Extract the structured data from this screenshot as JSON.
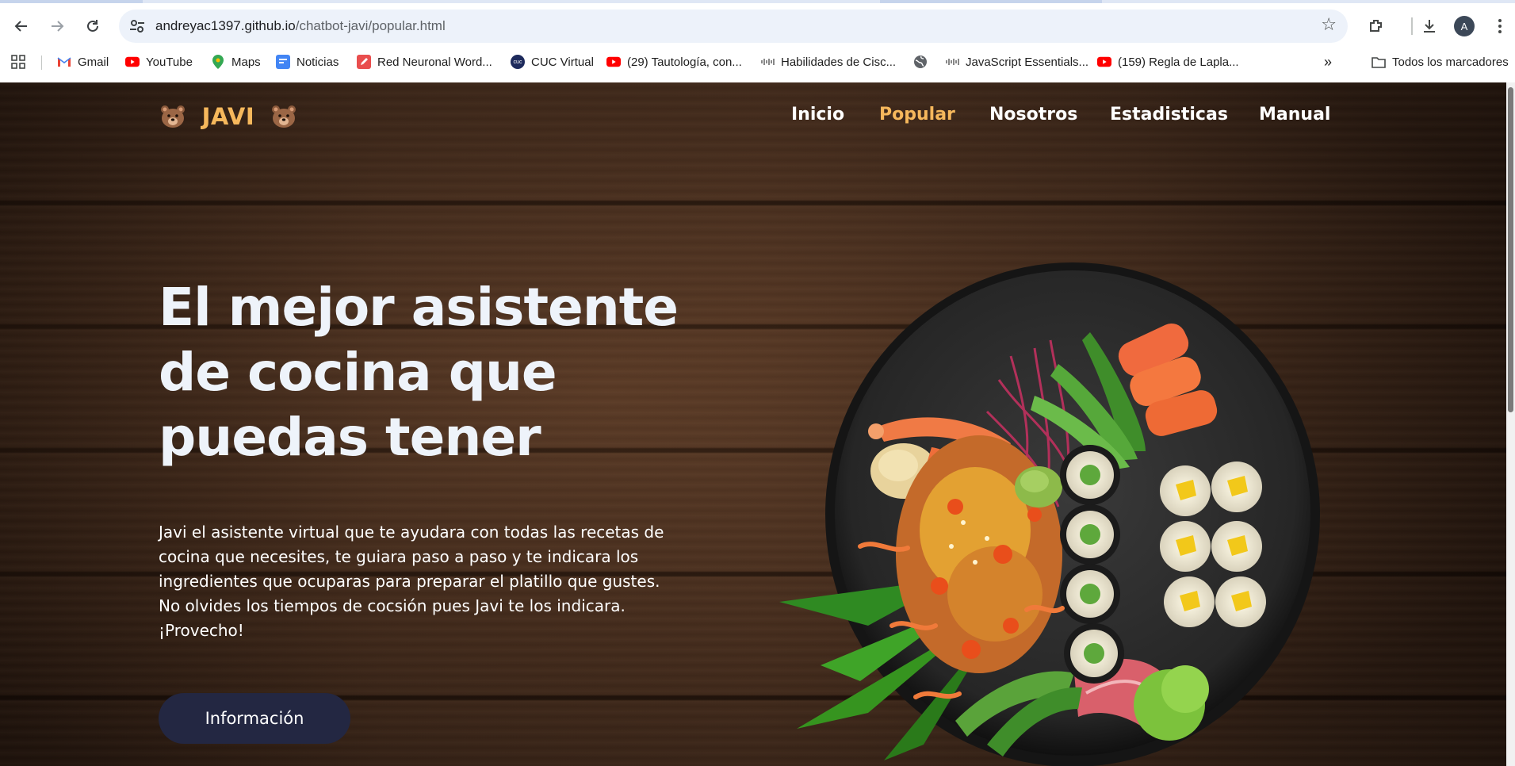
{
  "browser": {
    "url_host": "andreyac1397.github.io",
    "url_path": "/chatbot-javi/popular.html",
    "avatar_letter": "A",
    "bookmarks": [
      {
        "label": "Gmail",
        "icon": "gmail-icon"
      },
      {
        "label": "YouTube",
        "icon": "youtube-icon"
      },
      {
        "label": "Maps",
        "icon": "maps-icon"
      },
      {
        "label": "Noticias",
        "icon": "news-icon"
      },
      {
        "label": "Red Neuronal Word...",
        "icon": "pen-icon"
      },
      {
        "label": "CUC Virtual",
        "icon": "cuc-icon"
      },
      {
        "label": "(29) Tautología, con...",
        "icon": "youtube-icon"
      },
      {
        "label": "Habilidades de Cisc...",
        "icon": "cisco-icon"
      },
      {
        "label": "",
        "icon": "globe-icon"
      },
      {
        "label": "JavaScript Essentials...",
        "icon": "cisco-icon"
      },
      {
        "label": "(159) Regla de Lapla...",
        "icon": "youtube-icon"
      }
    ],
    "more_bookmarks": "»",
    "all_bookmarks": "Todos los marcadores"
  },
  "site": {
    "brand": "JAVI",
    "brand_emoji": "bear-face-icon",
    "nav": [
      {
        "label": "Inicio",
        "active": false
      },
      {
        "label": "Popular",
        "active": true
      },
      {
        "label": "Nosotros",
        "active": false
      },
      {
        "label": "Estadisticas",
        "active": false
      },
      {
        "label": "Manual",
        "active": false
      }
    ],
    "accent_color": "#f6b85c",
    "button_color": "#232742"
  },
  "hero": {
    "title_lines": [
      "El mejor asistente",
      "de cocina que",
      "puedas tener"
    ],
    "paragraph_lines": [
      "Javi el asistente virtual que te ayudara con todas las recetas de",
      "cocina que necesites, te guiara paso a paso y te indicara los",
      "ingredientes que ocuparas para preparar el platillo que gustes.",
      "No olvides los tiempos de cocsión pues Javi te los indicara.",
      "¡Provecho!"
    ],
    "button_label": "Información",
    "image": "sushi-plate-illustration"
  }
}
